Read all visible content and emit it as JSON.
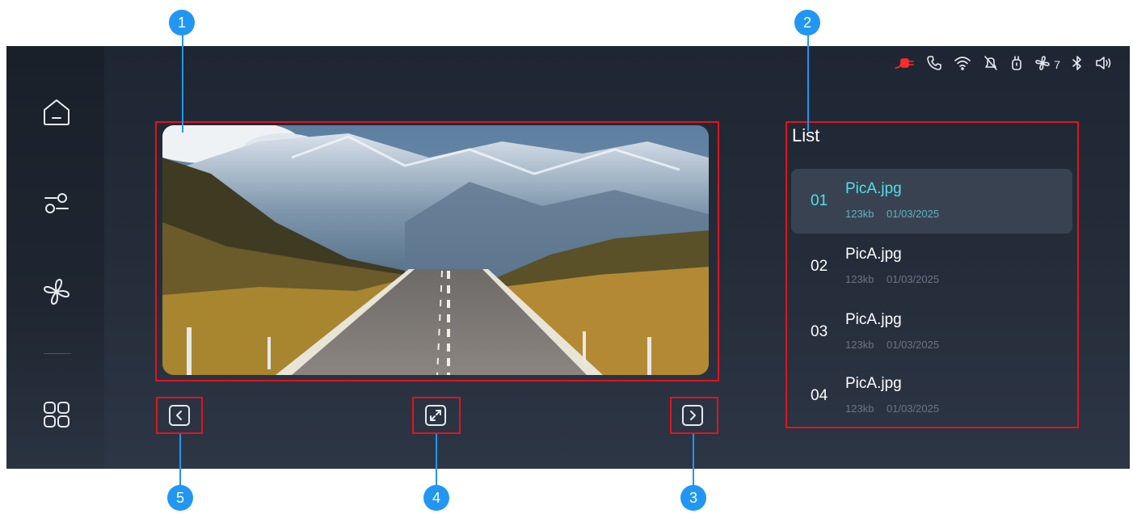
{
  "sidebar": {
    "items": [
      {
        "icon": "home-icon"
      },
      {
        "icon": "settings-sliders-icon"
      },
      {
        "icon": "fan-icon"
      },
      {
        "icon": "apps-grid-icon"
      }
    ]
  },
  "statusbar": {
    "icons": [
      "charging-plug-icon",
      "phone-icon",
      "wifi-icon",
      "notification-off-icon",
      "usb-icon",
      "fan-icon",
      "bluetooth-icon",
      "volume-icon"
    ],
    "fan_speed": "7",
    "accent_color": "#ff2b2b"
  },
  "viewer": {
    "image": "mountain-road-photo"
  },
  "controls": {
    "prev": "chevron-left-icon",
    "fullscreen": "expand-icon",
    "next": "chevron-right-icon"
  },
  "list": {
    "title": "List",
    "items": [
      {
        "num": "01",
        "name": "PicA.jpg",
        "size": "123kb",
        "date": "01/03/2025",
        "active": true
      },
      {
        "num": "02",
        "name": "PicA.jpg",
        "size": "123kb",
        "date": "01/03/2025",
        "active": false
      },
      {
        "num": "03",
        "name": "PicA.jpg",
        "size": "123kb",
        "date": "01/03/2025",
        "active": false
      },
      {
        "num": "04",
        "name": "PicA.jpg",
        "size": "123kb",
        "date": "01/03/2025",
        "active": false
      }
    ],
    "active_color": "#4fe0e8"
  },
  "annotations": {
    "labels": [
      "1",
      "2",
      "3",
      "4",
      "5"
    ],
    "box_color": "#e0141e",
    "callout_color": "#2196f3"
  }
}
